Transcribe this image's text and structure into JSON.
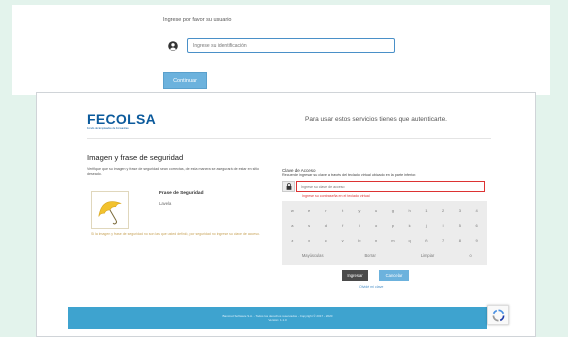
{
  "top": {
    "prompt": "Ingrese por favor su usuario",
    "username_placeholder": "Ingrese su identificación",
    "continue_label": "Continuar"
  },
  "modal": {
    "logo_text": "FECOLSA",
    "logo_subtitle": "Fondo de Empleados de Fonsanitas",
    "auth_message": "Para usar estos servicios tienes que autenticarte.",
    "security_title": "Imagen y frase de seguridad",
    "security_desc": "Verifique que su imagen y frase de seguridad sean correctas, de esta manera se asegurará de estar en sitio deseado.",
    "phrase_label": "Frase de Seguridad",
    "phrase_value": "Lavela",
    "warning_text": "Si la imagen y frase de seguridad no son las que usted definió, por seguridad no ingrese su clave de acceso.",
    "key_label": "Clave de Acceso",
    "key_desc": "Recuerde ingresar su clave a través del teclado virtual ubicado en la parte inferior.",
    "key_placeholder": "Ingrese su clave de acceso",
    "key_error": "Ingrese su contraseña en el teclado virtual",
    "keyboard": {
      "rows": [
        [
          "w",
          "e",
          "r",
          "t",
          "y",
          "u",
          "g",
          "h",
          "1",
          "2",
          "3",
          "4"
        ],
        [
          "a",
          "s",
          "d",
          "f",
          "i",
          "o",
          "p",
          "k",
          "j",
          "l",
          "5",
          "6"
        ],
        [
          "z",
          "x",
          "c",
          "v",
          "b",
          "n",
          "m",
          "q",
          "ñ",
          "7",
          "8",
          "9"
        ]
      ],
      "bottom": [
        "Mayúsculas",
        "Borrar",
        "Limpiar",
        "0"
      ]
    },
    "ingresar_label": "Ingresar",
    "cancelar_label": "Cancelar",
    "forgot_link": "Olvidé mi clave",
    "footer_line1": "Bancred Software S.A. - Todos los derechos reservados - Copyright © 2017 - 2020",
    "footer_line2": "Versión: 1.1.0"
  },
  "colors": {
    "page_bg": "#e3f3ec",
    "accent": "#6cb2dd",
    "footer": "#3ea3cf",
    "error": "#dd3333",
    "logo": "#0b5a9c"
  },
  "icons": {
    "user": "user-circle-icon",
    "lock": "lock-icon",
    "security_image": "umbrella-icon",
    "recaptcha": "recaptcha-icon"
  }
}
